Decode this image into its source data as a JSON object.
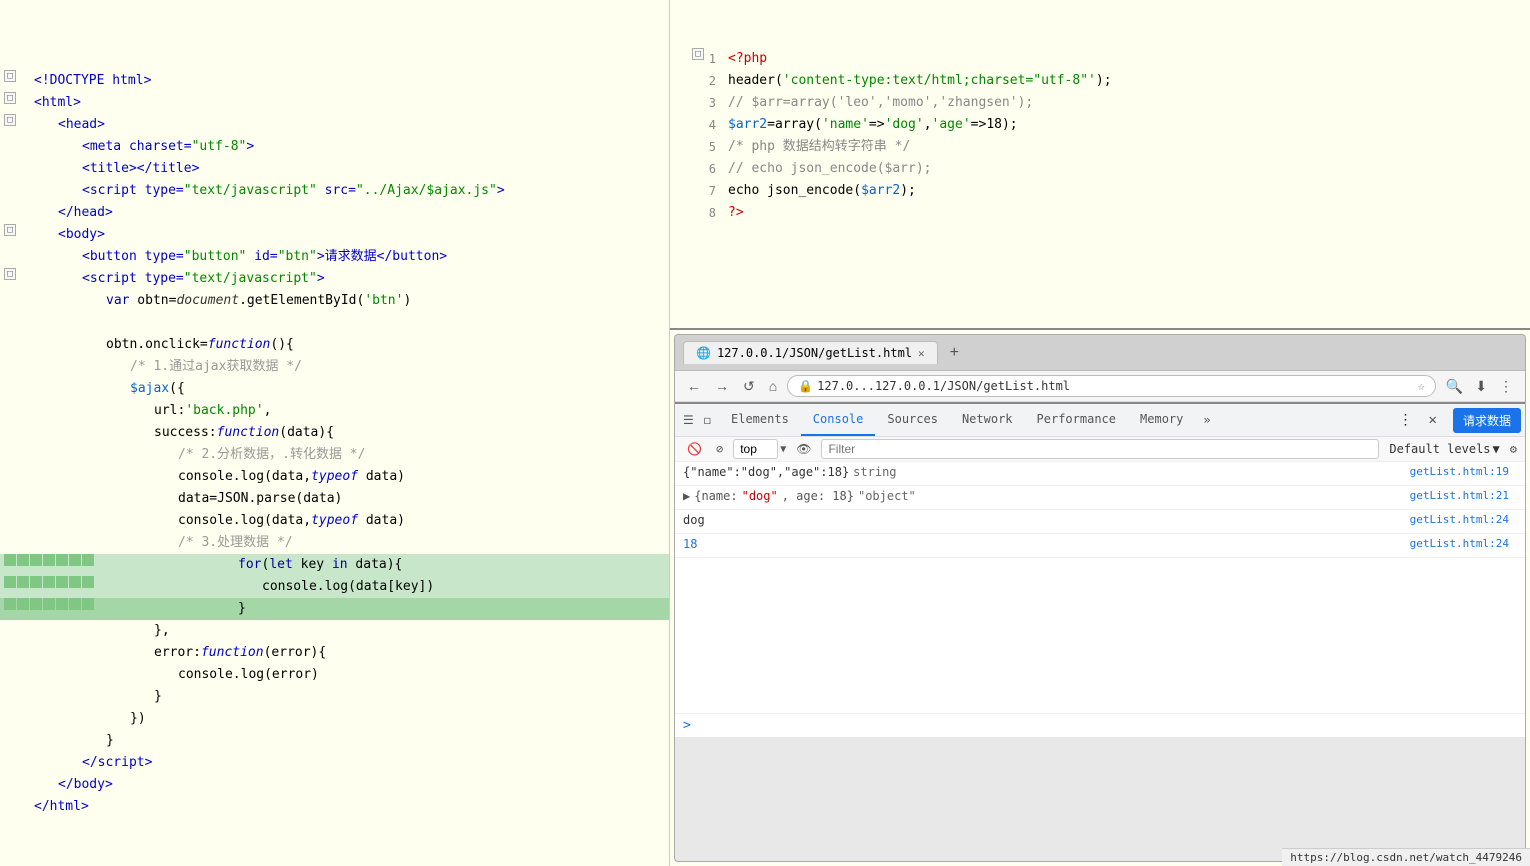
{
  "left_panel": {
    "lines": [
      {
        "num": "",
        "indent": 0,
        "fold": true,
        "content": "&lt;!DOCTYPE html&gt;",
        "type": "tag"
      },
      {
        "num": "",
        "indent": 0,
        "fold": true,
        "content": "&lt;html&gt;",
        "type": "tag"
      },
      {
        "num": "",
        "indent": 1,
        "fold": true,
        "content": "&lt;head&gt;",
        "type": "tag"
      },
      {
        "num": "",
        "indent": 2,
        "fold": false,
        "content": "&lt;meta charset=\"utf-8\"&gt;",
        "type": "tag"
      },
      {
        "num": "",
        "indent": 2,
        "fold": false,
        "content": "&lt;title&gt;&lt;/title&gt;",
        "type": "tag"
      },
      {
        "num": "",
        "indent": 2,
        "fold": false,
        "content": "&lt;script type=\"text/javascript\" src=\"../Ajax/$ajax.js\"&gt;",
        "type": "tag"
      },
      {
        "num": "",
        "indent": 1,
        "fold": false,
        "content": "&lt;/head&gt;",
        "type": "tag"
      },
      {
        "num": "",
        "indent": 1,
        "fold": true,
        "content": "&lt;body&gt;",
        "type": "tag"
      },
      {
        "num": "",
        "indent": 2,
        "fold": false,
        "content": "&lt;button type=\"button\" id=\"btn\"&gt;请求数据&lt;/button&gt;",
        "type": "tag"
      },
      {
        "num": "",
        "indent": 2,
        "fold": true,
        "content": "&lt;script type=\"text/javascript\"&gt;",
        "type": "tag"
      },
      {
        "num": "",
        "indent": 3,
        "fold": false,
        "content": "var obtn=document.getElementById('btn')",
        "type": "js"
      },
      {
        "num": "",
        "indent": 0,
        "fold": false,
        "content": "",
        "type": "blank"
      },
      {
        "num": "",
        "indent": 3,
        "fold": false,
        "content": "obtn.onclick=function(){",
        "type": "js"
      },
      {
        "num": "",
        "indent": 4,
        "fold": false,
        "content": "/* 1.通过ajax获取数据 */",
        "type": "comment"
      },
      {
        "num": "",
        "indent": 4,
        "fold": false,
        "content": "$ajax({",
        "type": "js"
      },
      {
        "num": "",
        "indent": 5,
        "fold": false,
        "content": "url:'back.php',",
        "type": "js"
      },
      {
        "num": "",
        "indent": 5,
        "fold": false,
        "content": "success:function(data){",
        "type": "js"
      },
      {
        "num": "",
        "indent": 6,
        "fold": false,
        "content": "/* 2.分析数据，转化数据 */",
        "type": "comment"
      },
      {
        "num": "",
        "indent": 6,
        "fold": false,
        "content": "console.log(data,typeof data)",
        "type": "js"
      },
      {
        "num": "",
        "indent": 6,
        "fold": false,
        "content": "data=JSON.parse(data)",
        "type": "js"
      },
      {
        "num": "",
        "indent": 6,
        "fold": false,
        "content": "console.log(data,typeof data)",
        "type": "js"
      },
      {
        "num": "",
        "indent": 6,
        "fold": false,
        "content": "/* 3.处理数据 */",
        "type": "comment"
      },
      {
        "num": "",
        "indent": 6,
        "fold": false,
        "content": "for(let key in data){",
        "type": "js",
        "highlight": true
      },
      {
        "num": "",
        "indent": 7,
        "fold": false,
        "content": "console.log(data[key])",
        "type": "js",
        "highlight": true
      },
      {
        "num": "",
        "indent": 6,
        "fold": false,
        "content": "}",
        "type": "js",
        "highlight_dark": true
      },
      {
        "num": "",
        "indent": 5,
        "fold": false,
        "content": "},",
        "type": "js"
      },
      {
        "num": "",
        "indent": 5,
        "fold": false,
        "content": "error:function(error){",
        "type": "js"
      },
      {
        "num": "",
        "indent": 6,
        "fold": false,
        "content": "console.log(error)",
        "type": "js"
      },
      {
        "num": "",
        "indent": 5,
        "fold": false,
        "content": "}",
        "type": "js"
      },
      {
        "num": "",
        "indent": 4,
        "fold": false,
        "content": "})",
        "type": "js"
      },
      {
        "num": "",
        "indent": 3,
        "fold": false,
        "content": "}",
        "type": "js"
      },
      {
        "num": "",
        "indent": 2,
        "fold": false,
        "content": "&lt;/script&gt;",
        "type": "tag"
      },
      {
        "num": "",
        "indent": 1,
        "fold": false,
        "content": "&lt;/body&gt;",
        "type": "tag"
      },
      {
        "num": "",
        "indent": 0,
        "fold": false,
        "content": "&lt;/html&gt;",
        "type": "tag"
      }
    ]
  },
  "php_panel": {
    "lines": [
      {
        "num": "1",
        "content": "&lt;?php",
        "type": "php-tag"
      },
      {
        "num": "2",
        "content": "header('content-type:text/html;charset=\"utf-8\"');",
        "type": "php"
      },
      {
        "num": "3",
        "content": "// $arr=array('leo','momo','zhangsen');",
        "type": "php-comment"
      },
      {
        "num": "4",
        "content": "$arr2=array('name'=&gt;'dog','age'=&gt;18);",
        "type": "php"
      },
      {
        "num": "5",
        "content": "/* php 数据结构转字符串 */",
        "type": "php-comment"
      },
      {
        "num": "6",
        "content": "// echo json_encode($arr);",
        "type": "php-comment"
      },
      {
        "num": "7",
        "content": "echo json_encode($arr2);",
        "type": "php"
      },
      {
        "num": "8",
        "content": "?&gt;",
        "type": "php-tag"
      }
    ]
  },
  "browser": {
    "tab_title": "127.0.0.1/JSON/getList.html",
    "address": "127.0...127.0.0.1/JSON/getList.html",
    "address_full": "127.0.0.1/JSON/getList.html",
    "new_tab_label": "+",
    "back_icon": "←",
    "forward_icon": "→",
    "reload_icon": "↺",
    "home_icon": "⌂",
    "request_btn_label": "请求数据"
  },
  "devtools": {
    "tabs": [
      "Elements",
      "Console",
      "Sources",
      "Network",
      "Performance",
      "Memory"
    ],
    "active_tab": "Console",
    "tab_icons": [
      "☰",
      "◻"
    ],
    "more_label": "»",
    "top_selector": "top",
    "filter_placeholder": "Filter",
    "default_levels": "Default levels",
    "console_rows": [
      {
        "message": "{\"name\":\"dog\",\"age\":18} string",
        "link": "getList.html:19",
        "type": "string"
      },
      {
        "message": "{name: \"dog\", age: 18} \"object\"",
        "link": "getList.html:21",
        "type": "object",
        "expandable": true
      },
      {
        "message": "dog",
        "link": "getList.html:24",
        "type": "string"
      },
      {
        "message": "18",
        "link": "getList.html:24",
        "type": "number"
      }
    ]
  },
  "bottom_url": "https://blog.csdn.net/watch_4479246"
}
